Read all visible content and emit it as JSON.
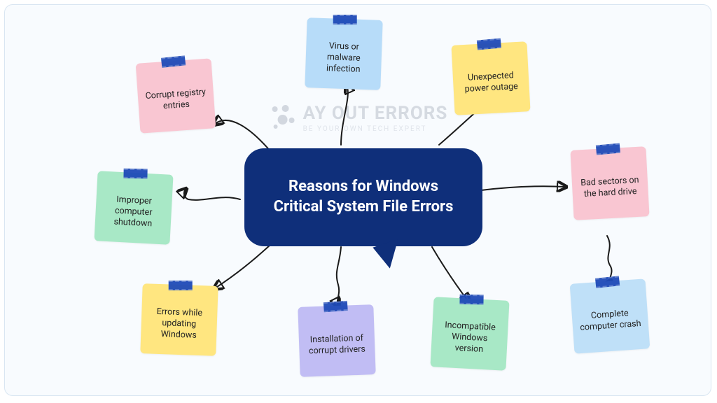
{
  "watermark": {
    "title": "AY OUT ERRORS",
    "subtitle": "BE YOUR OWN TECH EXPERT"
  },
  "center": {
    "title": "Reasons for Windows Critical System File Errors"
  },
  "notes": [
    {
      "id": "corrupt-registry",
      "label": "Corrupt registry entries"
    },
    {
      "id": "virus-malware",
      "label": "Virus or malware infection"
    },
    {
      "id": "unexpected-power",
      "label": "Unexpected power outage"
    },
    {
      "id": "improper-shutdown",
      "label": "Improper computer shutdown"
    },
    {
      "id": "bad-sectors",
      "label": "Bad sectors on the hard drive"
    },
    {
      "id": "errors-updating",
      "label": "Errors while updating Windows"
    },
    {
      "id": "corrupt-drivers",
      "label": "Installation of corrupt drivers"
    },
    {
      "id": "incompatible-windows",
      "label": "Incompatible Windows version"
    },
    {
      "id": "complete-crash",
      "label": "Complete computer crash"
    }
  ]
}
